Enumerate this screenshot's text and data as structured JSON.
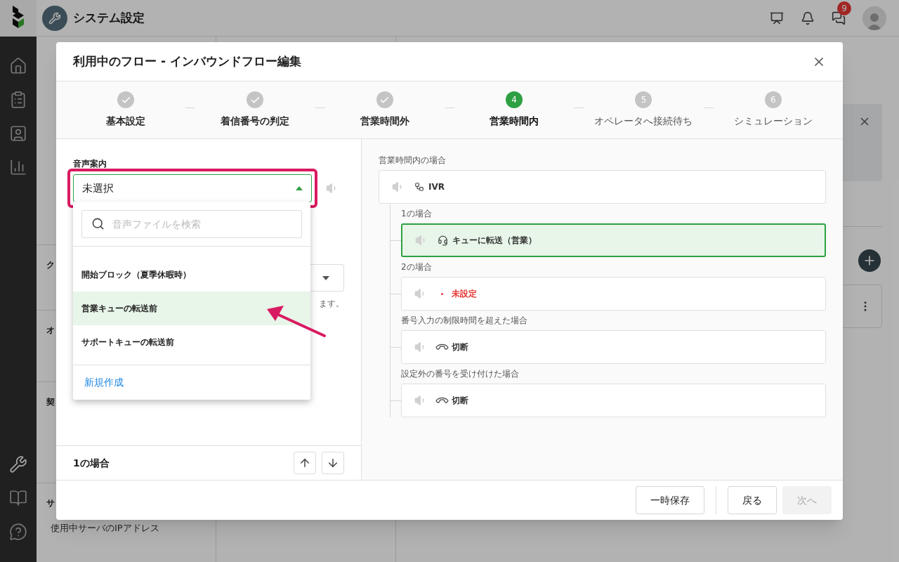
{
  "app": {
    "title": "システム設定",
    "notification_count": "9"
  },
  "background_nav": {
    "sections": [
      {
        "heading": "ク"
      },
      {
        "heading": "オ"
      },
      {
        "heading": "契"
      },
      {
        "heading": "サ",
        "items": [
          {
            "text": "使用中サーバのIPアドレス"
          }
        ]
      }
    ]
  },
  "dialog": {
    "title": "利用中のフロー - インバウンドフロー編集",
    "steps": [
      {
        "label": "基本設定",
        "completed": true,
        "current": false
      },
      {
        "label": "着信番号の判定",
        "completed": true,
        "current": false
      },
      {
        "label": "営業時間外",
        "completed": true,
        "current": false
      },
      {
        "label": "営業時間内",
        "number": "4",
        "completed": false,
        "current": true
      },
      {
        "label": "オペレータへ接続待ち",
        "number": "5",
        "completed": false,
        "current": false
      },
      {
        "label": "シミュレーション",
        "number": "6",
        "completed": false,
        "current": false
      }
    ],
    "left": {
      "field_label": "音声案内",
      "select_value": "未選択",
      "hint_fragment": "ます。",
      "dropdown": {
        "search_placeholder": "音声ファイルを検索",
        "options": [
          {
            "label": "開始ブロック（夏季休暇時）",
            "selected": false
          },
          {
            "label": "営業キューの転送前",
            "selected": true
          },
          {
            "label": "サポートキューの転送前",
            "selected": false
          }
        ],
        "create_link": "新規作成"
      },
      "footer_label": "1の場合"
    },
    "right": {
      "label": "営業時間内の場合",
      "root": {
        "title": "IVR"
      },
      "branches": [
        {
          "label": "1の場合",
          "action": "キューに転送（営業）",
          "kind": "queue",
          "selected": true
        },
        {
          "label": "2の場合",
          "action": "未設定",
          "kind": "unset",
          "selected": false
        },
        {
          "label": "番号入力の制限時間を超えた場合",
          "action": "切断",
          "kind": "hangup",
          "selected": false
        },
        {
          "label": "設定外の番号を受け付けた場合",
          "action": "切断",
          "kind": "hangup",
          "selected": false
        }
      ]
    },
    "footer": {
      "save_buttons": [
        {
          "label": "一時保存",
          "disabled": false
        }
      ],
      "nav_buttons": [
        {
          "label": "戻る",
          "disabled": false
        },
        {
          "label": "次へ",
          "disabled": true
        }
      ]
    }
  }
}
